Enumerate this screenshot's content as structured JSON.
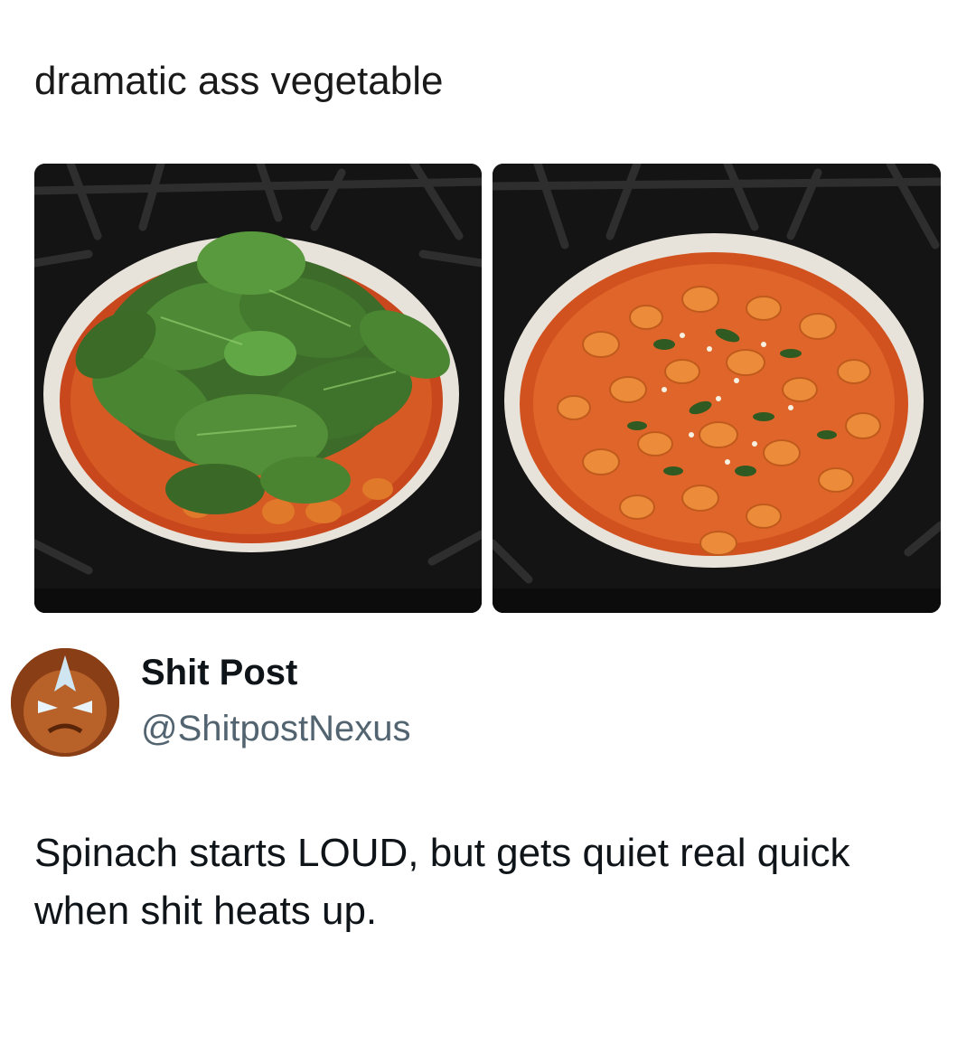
{
  "caption": "dramatic ass vegetable",
  "images": [
    {
      "name": "spinach-raw-photo",
      "icon": "pan-with-raw-spinach"
    },
    {
      "name": "spinach-cooked-photo",
      "icon": "pan-with-cooked-gnocchi"
    }
  ],
  "tweet": {
    "author": {
      "display_name": "Shit Post",
      "handle": "@ShitpostNexus",
      "avatar_icon": "avatar-cartoon-face"
    },
    "text": "Spinach starts LOUD, but gets quiet real quick when shit heats up."
  },
  "colors": {
    "handle": "#536471",
    "text": "#0f1419"
  }
}
